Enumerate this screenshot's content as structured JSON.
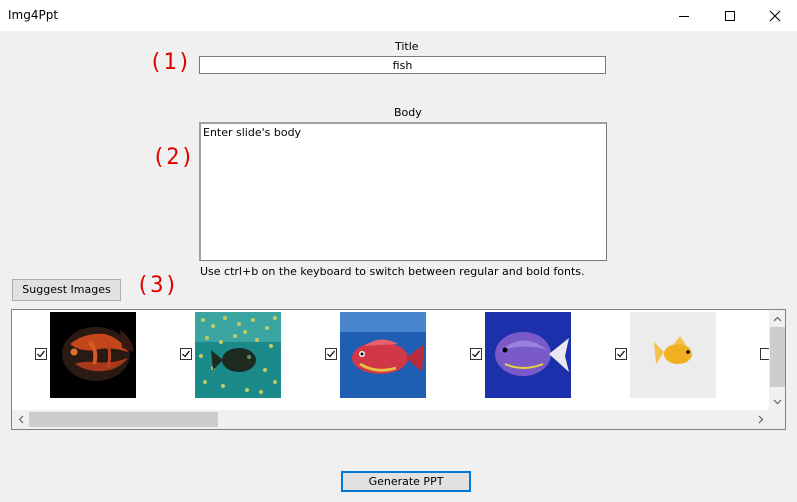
{
  "window": {
    "title": "Img4Ppt",
    "controls": [
      "minimize-icon",
      "maximize-icon",
      "close-icon"
    ]
  },
  "form": {
    "title_label": "Title",
    "title_value": "fish",
    "body_label": "Body",
    "body_value": "Enter slide's body",
    "hint": "Use ctrl+b on the keyboard to switch between regular and bold fonts."
  },
  "annotations": [
    "(1)",
    "(2)",
    "(3)"
  ],
  "buttons": {
    "suggest": "Suggest Images",
    "generate": "Generate PPT"
  },
  "images": [
    {
      "checked": true,
      "subject": "dark oscar fish on black"
    },
    {
      "checked": true,
      "subject": "fish swimming among school of small fish"
    },
    {
      "checked": true,
      "subject": "red fish on blue background"
    },
    {
      "checked": true,
      "subject": "purple tang fish"
    },
    {
      "checked": true,
      "subject": "goldfish on white"
    },
    {
      "checked": false,
      "subject": "partially visible"
    }
  ],
  "colors": {
    "annotation": "#e00000",
    "focus_border": "#0078d7",
    "window_bg": "#f0f0f0"
  }
}
